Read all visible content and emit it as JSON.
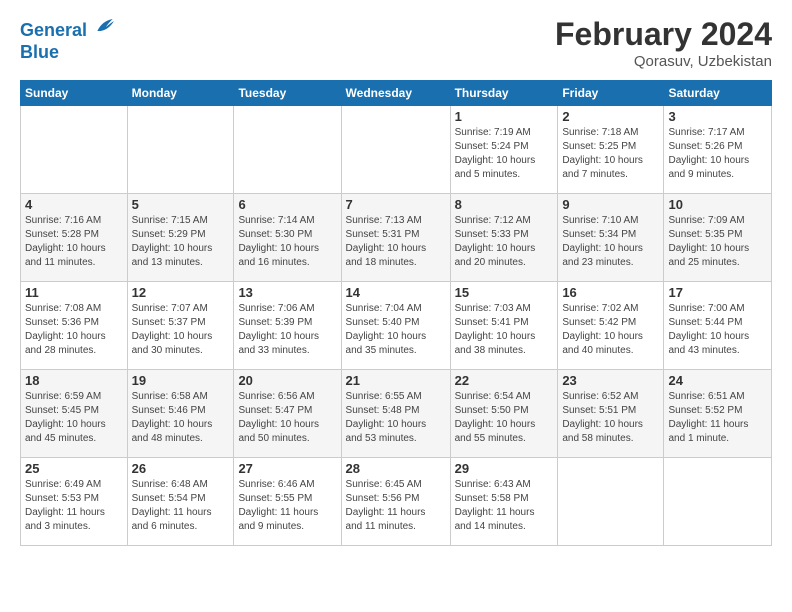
{
  "app": {
    "name_line1": "General",
    "name_line2": "Blue"
  },
  "title": "February 2024",
  "subtitle": "Qorasuv, Uzbekistan",
  "days_of_week": [
    "Sunday",
    "Monday",
    "Tuesday",
    "Wednesday",
    "Thursday",
    "Friday",
    "Saturday"
  ],
  "weeks": [
    [
      {
        "day": "",
        "info": ""
      },
      {
        "day": "",
        "info": ""
      },
      {
        "day": "",
        "info": ""
      },
      {
        "day": "",
        "info": ""
      },
      {
        "day": "1",
        "info": "Sunrise: 7:19 AM\nSunset: 5:24 PM\nDaylight: 10 hours\nand 5 minutes."
      },
      {
        "day": "2",
        "info": "Sunrise: 7:18 AM\nSunset: 5:25 PM\nDaylight: 10 hours\nand 7 minutes."
      },
      {
        "day": "3",
        "info": "Sunrise: 7:17 AM\nSunset: 5:26 PM\nDaylight: 10 hours\nand 9 minutes."
      }
    ],
    [
      {
        "day": "4",
        "info": "Sunrise: 7:16 AM\nSunset: 5:28 PM\nDaylight: 10 hours\nand 11 minutes."
      },
      {
        "day": "5",
        "info": "Sunrise: 7:15 AM\nSunset: 5:29 PM\nDaylight: 10 hours\nand 13 minutes."
      },
      {
        "day": "6",
        "info": "Sunrise: 7:14 AM\nSunset: 5:30 PM\nDaylight: 10 hours\nand 16 minutes."
      },
      {
        "day": "7",
        "info": "Sunrise: 7:13 AM\nSunset: 5:31 PM\nDaylight: 10 hours\nand 18 minutes."
      },
      {
        "day": "8",
        "info": "Sunrise: 7:12 AM\nSunset: 5:33 PM\nDaylight: 10 hours\nand 20 minutes."
      },
      {
        "day": "9",
        "info": "Sunrise: 7:10 AM\nSunset: 5:34 PM\nDaylight: 10 hours\nand 23 minutes."
      },
      {
        "day": "10",
        "info": "Sunrise: 7:09 AM\nSunset: 5:35 PM\nDaylight: 10 hours\nand 25 minutes."
      }
    ],
    [
      {
        "day": "11",
        "info": "Sunrise: 7:08 AM\nSunset: 5:36 PM\nDaylight: 10 hours\nand 28 minutes."
      },
      {
        "day": "12",
        "info": "Sunrise: 7:07 AM\nSunset: 5:37 PM\nDaylight: 10 hours\nand 30 minutes."
      },
      {
        "day": "13",
        "info": "Sunrise: 7:06 AM\nSunset: 5:39 PM\nDaylight: 10 hours\nand 33 minutes."
      },
      {
        "day": "14",
        "info": "Sunrise: 7:04 AM\nSunset: 5:40 PM\nDaylight: 10 hours\nand 35 minutes."
      },
      {
        "day": "15",
        "info": "Sunrise: 7:03 AM\nSunset: 5:41 PM\nDaylight: 10 hours\nand 38 minutes."
      },
      {
        "day": "16",
        "info": "Sunrise: 7:02 AM\nSunset: 5:42 PM\nDaylight: 10 hours\nand 40 minutes."
      },
      {
        "day": "17",
        "info": "Sunrise: 7:00 AM\nSunset: 5:44 PM\nDaylight: 10 hours\nand 43 minutes."
      }
    ],
    [
      {
        "day": "18",
        "info": "Sunrise: 6:59 AM\nSunset: 5:45 PM\nDaylight: 10 hours\nand 45 minutes."
      },
      {
        "day": "19",
        "info": "Sunrise: 6:58 AM\nSunset: 5:46 PM\nDaylight: 10 hours\nand 48 minutes."
      },
      {
        "day": "20",
        "info": "Sunrise: 6:56 AM\nSunset: 5:47 PM\nDaylight: 10 hours\nand 50 minutes."
      },
      {
        "day": "21",
        "info": "Sunrise: 6:55 AM\nSunset: 5:48 PM\nDaylight: 10 hours\nand 53 minutes."
      },
      {
        "day": "22",
        "info": "Sunrise: 6:54 AM\nSunset: 5:50 PM\nDaylight: 10 hours\nand 55 minutes."
      },
      {
        "day": "23",
        "info": "Sunrise: 6:52 AM\nSunset: 5:51 PM\nDaylight: 10 hours\nand 58 minutes."
      },
      {
        "day": "24",
        "info": "Sunrise: 6:51 AM\nSunset: 5:52 PM\nDaylight: 11 hours\nand 1 minute."
      }
    ],
    [
      {
        "day": "25",
        "info": "Sunrise: 6:49 AM\nSunset: 5:53 PM\nDaylight: 11 hours\nand 3 minutes."
      },
      {
        "day": "26",
        "info": "Sunrise: 6:48 AM\nSunset: 5:54 PM\nDaylight: 11 hours\nand 6 minutes."
      },
      {
        "day": "27",
        "info": "Sunrise: 6:46 AM\nSunset: 5:55 PM\nDaylight: 11 hours\nand 9 minutes."
      },
      {
        "day": "28",
        "info": "Sunrise: 6:45 AM\nSunset: 5:56 PM\nDaylight: 11 hours\nand 11 minutes."
      },
      {
        "day": "29",
        "info": "Sunrise: 6:43 AM\nSunset: 5:58 PM\nDaylight: 11 hours\nand 14 minutes."
      },
      {
        "day": "",
        "info": ""
      },
      {
        "day": "",
        "info": ""
      }
    ]
  ]
}
